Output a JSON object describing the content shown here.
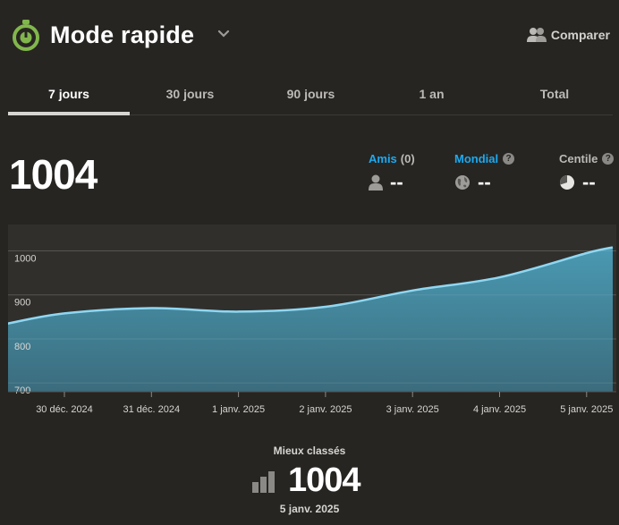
{
  "header": {
    "title": "Mode rapide",
    "compare_label": "Comparer",
    "accent_color": "#81b64c"
  },
  "tabs": [
    {
      "label": "7 jours",
      "active": true
    },
    {
      "label": "30 jours",
      "active": false
    },
    {
      "label": "90 jours",
      "active": false
    },
    {
      "label": "1 an",
      "active": false
    },
    {
      "label": "Total",
      "active": false
    }
  ],
  "rating": "1004",
  "stats": {
    "friends": {
      "label": "Amis",
      "count": "(0)",
      "value": "--",
      "color": "#1baaf1"
    },
    "global": {
      "label": "Mondial",
      "value": "--",
      "color": "#1baaf1"
    },
    "percentile": {
      "label": "Centile",
      "value": "--",
      "color": "#bcbab7"
    }
  },
  "chart_data": {
    "type": "area",
    "x": [
      "30 déc. 2024",
      "31 déc. 2024",
      "1 janv. 2025",
      "2 janv. 2025",
      "3 janv. 2025",
      "4 janv. 2025",
      "5 janv. 2025"
    ],
    "ylim": [
      680,
      1060
    ],
    "y_ticks": [
      "1000",
      "900",
      "800",
      "700"
    ],
    "points": [
      {
        "x": -0.65,
        "y": 835
      },
      {
        "x": 0,
        "y": 858
      },
      {
        "x": 1,
        "y": 870
      },
      {
        "x": 2,
        "y": 862
      },
      {
        "x": 3,
        "y": 873
      },
      {
        "x": 4,
        "y": 910
      },
      {
        "x": 5,
        "y": 940
      },
      {
        "x": 6,
        "y": 995
      },
      {
        "x": 6.3,
        "y": 1008
      }
    ],
    "line_color": "#8fd7f2",
    "fill_color": "#3f8aa0",
    "grid": true
  },
  "best": {
    "label": "Mieux classés",
    "value": "1004",
    "date": "5 janv. 2025"
  }
}
